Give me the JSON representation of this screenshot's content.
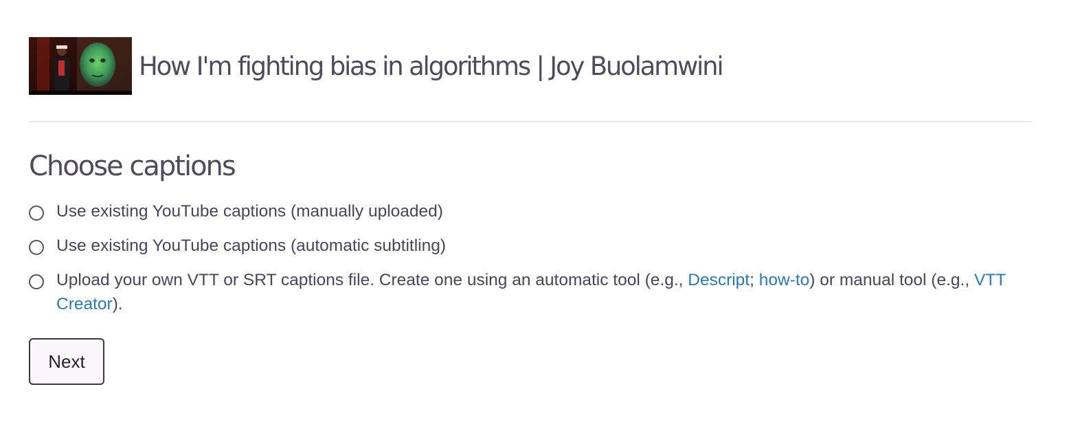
{
  "header": {
    "video_title": "How I'm fighting bias in algorithms | Joy Buolamwini",
    "thumbnail_alt": "video thumbnail"
  },
  "section": {
    "title": "Choose captions"
  },
  "options": [
    {
      "label": "Use existing YouTube captions (manually uploaded)"
    },
    {
      "label": "Use existing YouTube captions (automatic subtitling)"
    },
    {
      "text_1": "Upload your own VTT or SRT captions file. Create one using an automatic tool (e.g., ",
      "link_descript": "Descript",
      "text_2": "; ",
      "link_howto": "how-to",
      "text_3": ") or manual tool (e.g., ",
      "link_vtt_creator": "VTT Creator",
      "text_4": ")."
    }
  ],
  "actions": {
    "next_label": "Next"
  },
  "colors": {
    "heading": "#4f4a5c",
    "body_text": "#4a4458",
    "link": "#2a7ab8",
    "divider": "#e8e8ea",
    "button_bg": "#fbf7fc"
  },
  "icons": {
    "radio": "radio-circle-icon"
  }
}
